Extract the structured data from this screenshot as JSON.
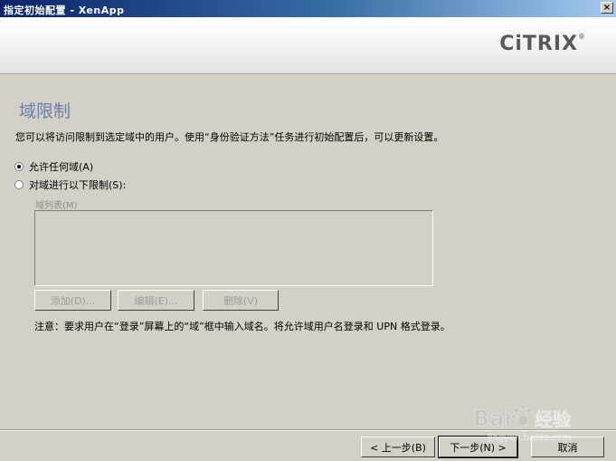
{
  "window": {
    "title": "指定初始配置 - XenApp",
    "close_symbol": "×"
  },
  "header": {
    "logo_text": "CiTRIX",
    "logo_mark": "®"
  },
  "page": {
    "title": "域限制",
    "description": "您可以将访问限制到选定域中的用户。使用“身份验证方法”任务进行初始配置后，可以更新设置。"
  },
  "options": {
    "allow_any": {
      "label": "允许任何域(A)",
      "checked": true
    },
    "restrict": {
      "label": "对域进行以下限制(S):",
      "checked": false
    }
  },
  "domain_list": {
    "label": "域列表(M)",
    "items": []
  },
  "list_buttons": {
    "add": "添加(D)...",
    "edit": "编辑(E)...",
    "remove": "删除(V)"
  },
  "note": "注意：要求用户在“登录”屏幕上的“域”框中输入域名。将允许域用户名登录和 UPN 格式登录。",
  "footer": {
    "back": "< 上一步(B)",
    "next": "下一步(N) >",
    "cancel": "取消"
  },
  "watermark": {
    "brand": "Bai",
    "brand2": "经验",
    "url": "jingyan.baidu.com"
  }
}
